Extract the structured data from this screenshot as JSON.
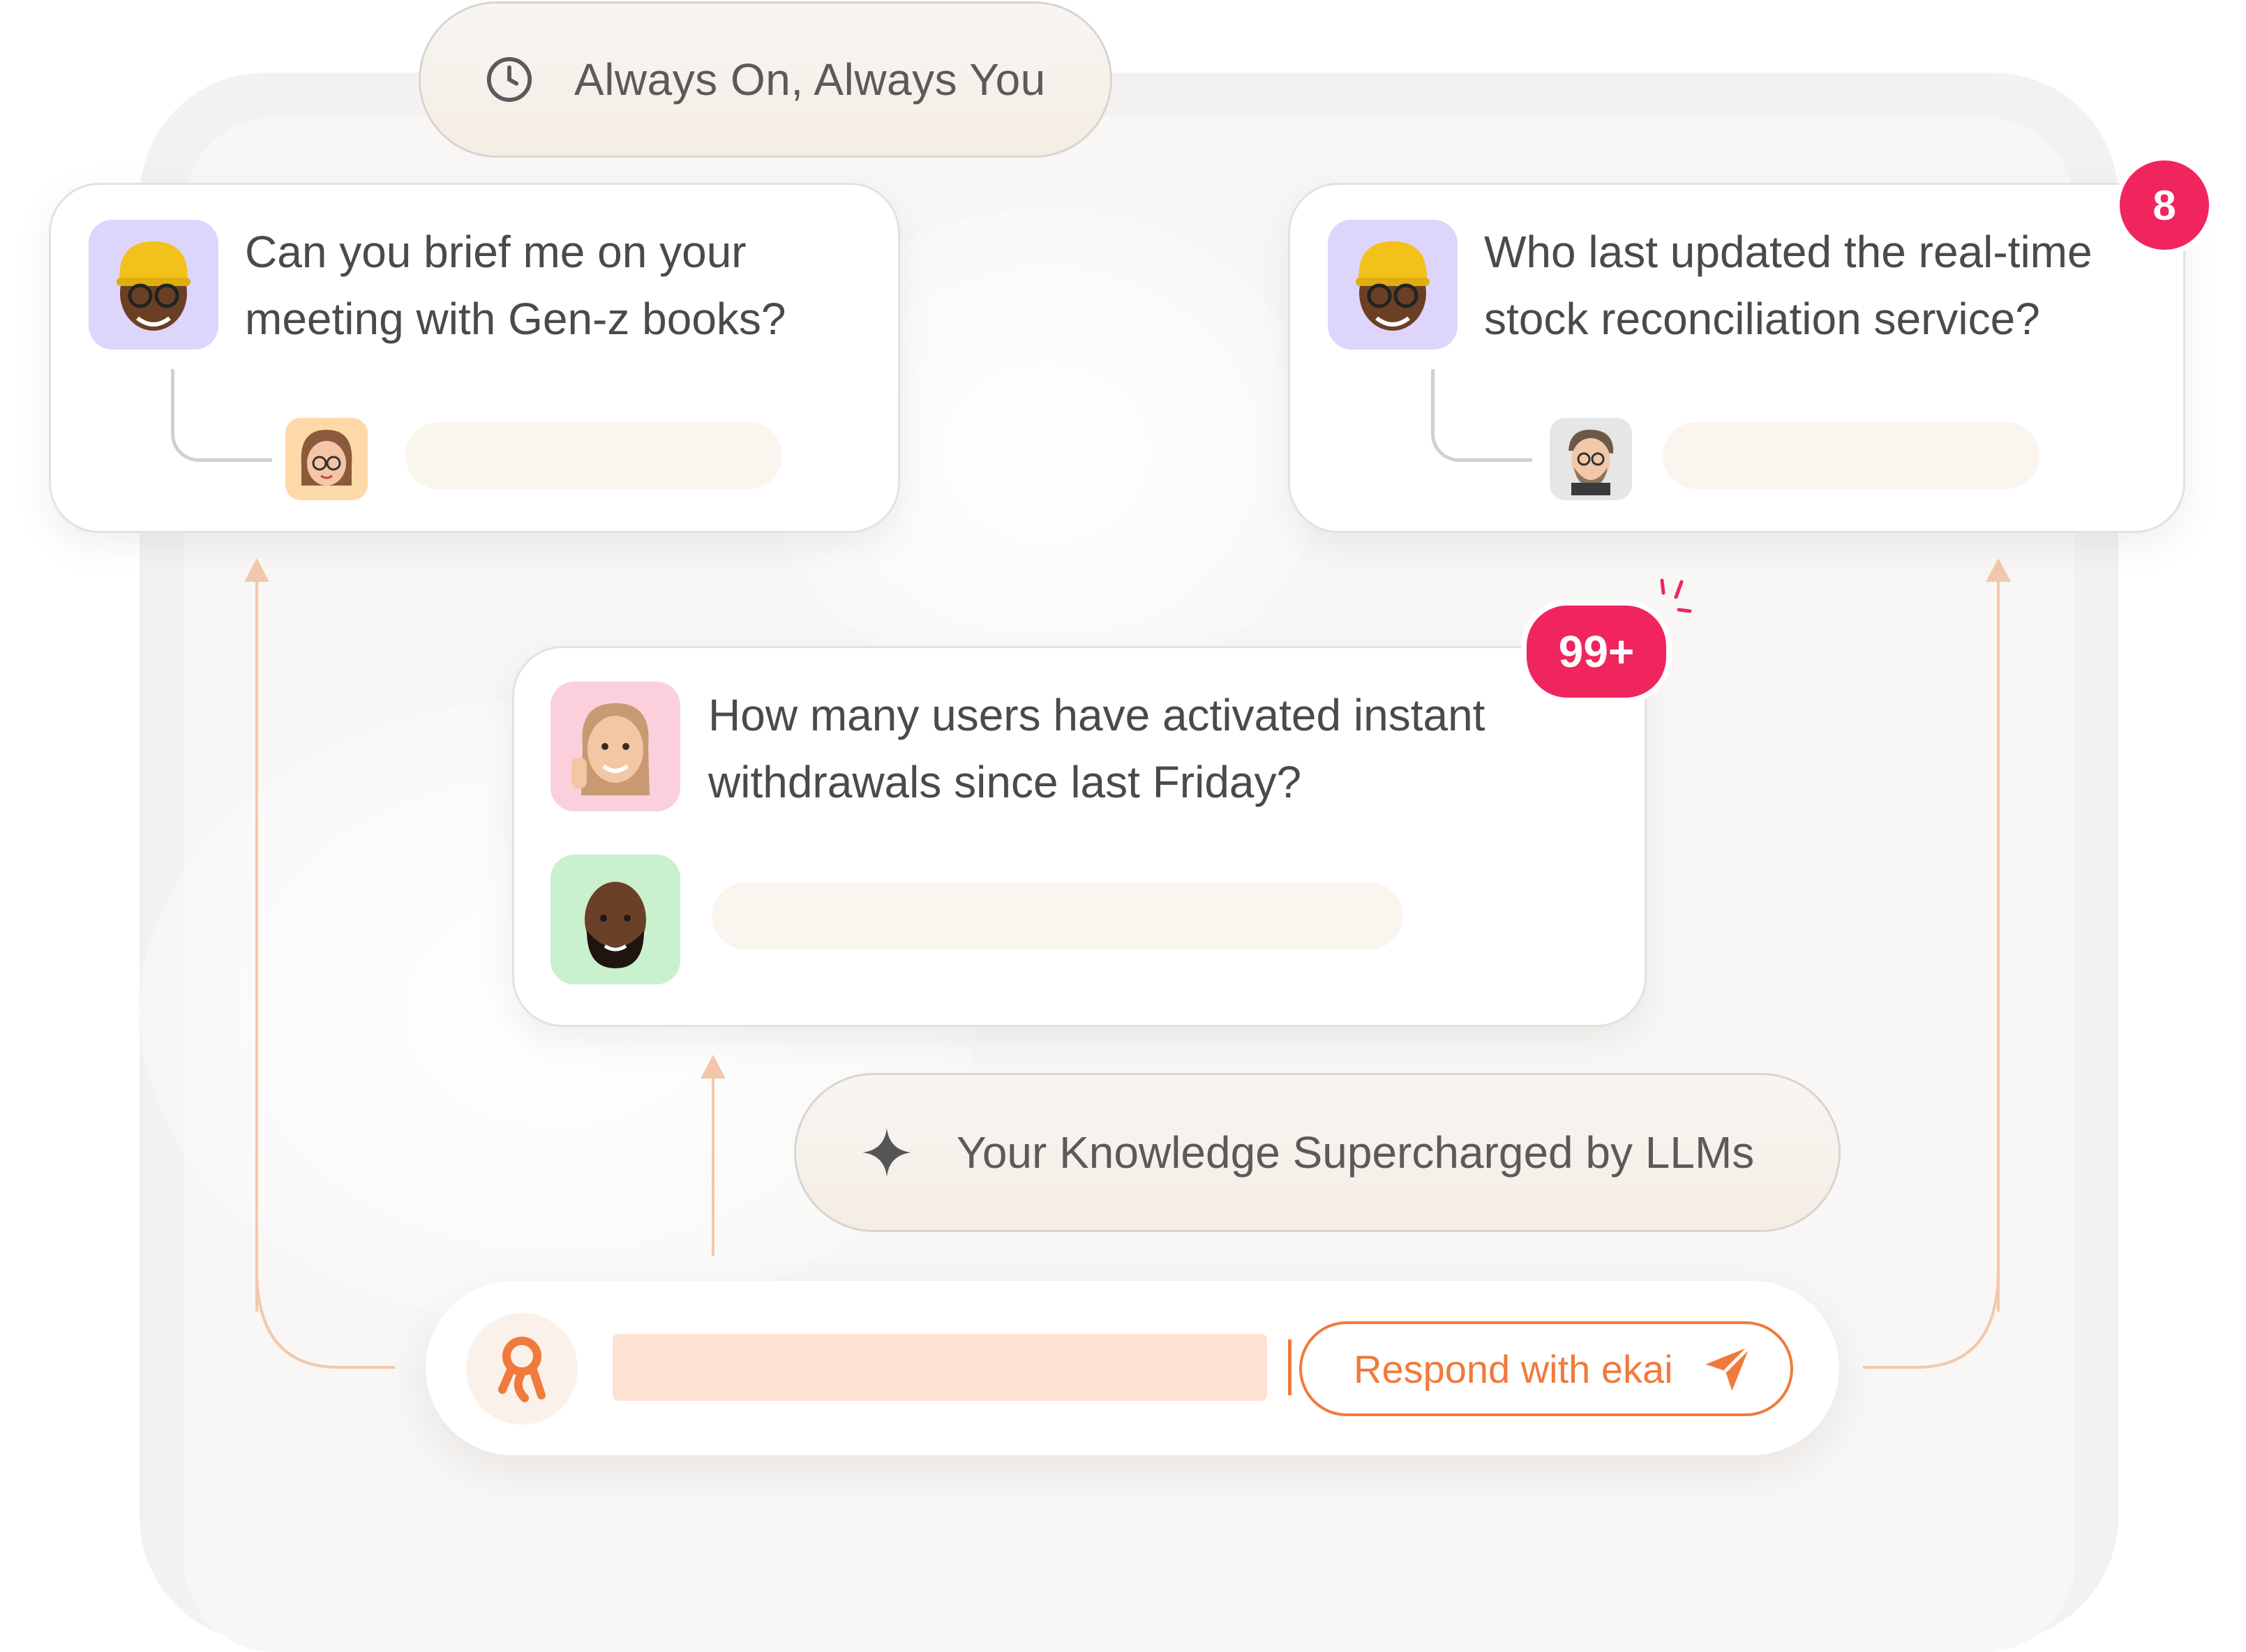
{
  "top_pill": {
    "label": "Always On, Always You",
    "icon": "clock-icon"
  },
  "cards": {
    "left": {
      "question": "Can you brief me on your meeting with Gen-z books?",
      "asker_avatar": "memoji-yellow-cap",
      "responder_avatar": "memoji-woman-glasses"
    },
    "right": {
      "question": "Who last updated the real-time stock reconciliation service?",
      "asker_avatar": "memoji-yellow-cap",
      "responder_avatar": "memoji-man-beard",
      "badge": "8"
    },
    "middle": {
      "question": "How many users have activated instant withdrawals since last Friday?",
      "asker_avatar": "memoji-woman-pink",
      "responder_avatar": "memoji-man-bald",
      "badge": "99+"
    }
  },
  "mid_pill": {
    "label": "Your Knowledge Supercharged by LLMs",
    "icon": "sparkle-icon"
  },
  "respond_bar": {
    "button_label": "Respond with ekai",
    "logo": "ekai-logo-icon",
    "send_icon": "send-icon"
  },
  "colors": {
    "accent": "#f07a3c",
    "badge": "#f0255e",
    "avatar_purple": "#ddd5fb",
    "avatar_pink": "#fbd0dc",
    "avatar_green": "#c9f1cd",
    "avatar_orange": "#fed9a8"
  }
}
